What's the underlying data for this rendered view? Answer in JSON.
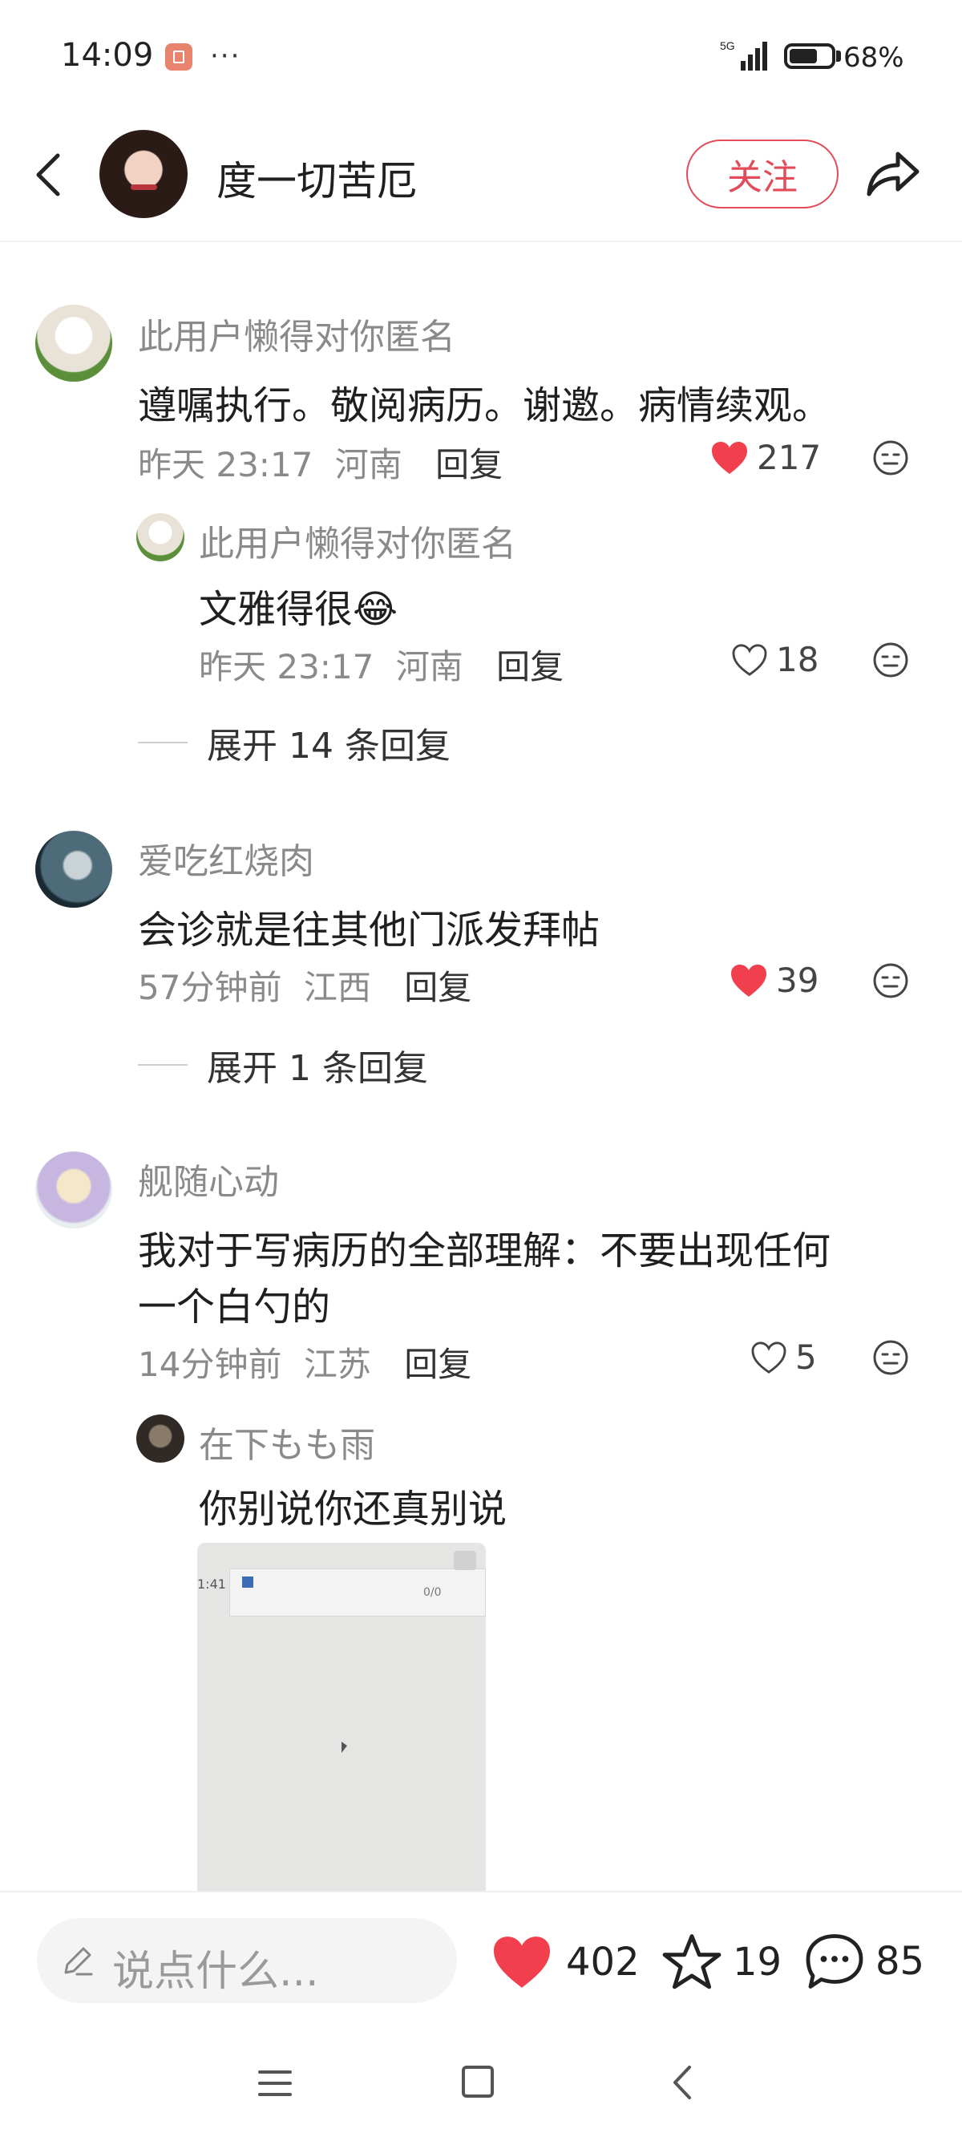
{
  "status_bar": {
    "time": "14:09",
    "dots": "···",
    "network": "5G",
    "battery_percent": "68%",
    "battery_level": 0.68
  },
  "header": {
    "author_name": "度一切苦厄",
    "follow_label": "关注"
  },
  "comments": [
    {
      "username": "此用户懒得对你匿名",
      "text": "遵嘱执行。敬阅病历。谢邀。病情续观。",
      "time": "昨天 23:17",
      "location": "河南",
      "reply_label": "回复",
      "likes": "217",
      "liked": true
    },
    {
      "username": "此用户懒得对你匿名",
      "text": "文雅得很",
      "emoji": "😂",
      "time": "昨天 23:17",
      "location": "河南",
      "reply_label": "回复",
      "likes": "18",
      "liked": false
    },
    {
      "expand_label": "展开 14 条回复"
    },
    {
      "username": "爱吃红烧肉",
      "text": "会诊就是往其他门派发拜帖",
      "time": "57分钟前",
      "location": "江西",
      "reply_label": "回复",
      "likes": "39",
      "liked": true
    },
    {
      "expand_label": "展开 1 条回复"
    },
    {
      "username": "舰随心动",
      "text_line1": "我对于写病历的全部理解：不要出现任何",
      "text_line2": "一个白勺的",
      "time": "14分钟前",
      "location": "江苏",
      "reply_label": "回复",
      "likes": "5",
      "liked": false
    },
    {
      "username": "在下もも雨",
      "text": "你别说你还真别说",
      "image_time_text": "1:41",
      "image_counter": "0/0"
    }
  ],
  "bottom_bar": {
    "input_placeholder": "说点什么...",
    "likes": "402",
    "stars": "19",
    "comments": "85"
  },
  "colors": {
    "accent_red": "#f23f4e",
    "follow_red": "#e24c5a",
    "meta_gray": "#8a8a8a"
  }
}
